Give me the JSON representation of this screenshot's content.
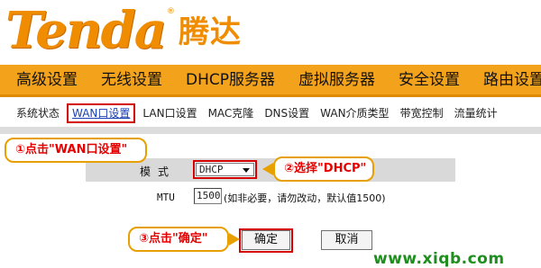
{
  "brand": {
    "latin": "Tenda",
    "registered": "®",
    "chinese": "腾达",
    "color": "#f08c00"
  },
  "main_nav": {
    "items": [
      "高级设置",
      "无线设置",
      "DHCP服务器",
      "虚拟服务器",
      "安全设置",
      "路由设置"
    ]
  },
  "sub_nav": {
    "items": [
      "系统状态",
      "WAN口设置",
      "LAN口设置",
      "MAC克隆",
      "DNS设置",
      "WAN介质类型",
      "带宽控制",
      "流量统计"
    ],
    "active": "WAN口设置"
  },
  "annotations": {
    "step1": "①点击\"WAN口设置\"",
    "step2": "②选择\"DHCP\"",
    "step3": "③点击\"确定\""
  },
  "form": {
    "mode_label": "模式",
    "mode_value": "DHCP",
    "mtu_label": "MTU",
    "mtu_value": "1500",
    "mtu_hint": "(如非必要，请勿改动，默认值1500)"
  },
  "buttons": {
    "ok": "确定",
    "cancel": "取消"
  },
  "watermark": "www.xiqb.com",
  "colors": {
    "nav_bg": "#f3a21b",
    "highlight": "#d40000",
    "callout_border": "#e8a000",
    "callout_text": "#e60000",
    "watermark": "#1e8f1e"
  }
}
